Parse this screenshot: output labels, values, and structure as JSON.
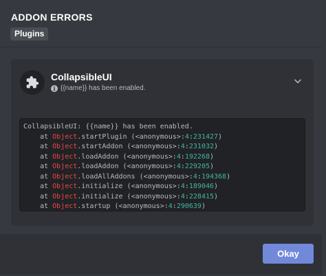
{
  "modal": {
    "title": "ADDON ERRORS",
    "tab_label": "Plugins"
  },
  "addon": {
    "name": "CollapsibleUI",
    "message": "{{name}} has been enabled.",
    "avatar_icon": "puzzle-piece-icon",
    "info_icon": "info-icon",
    "expand_icon": "chevron-down-icon"
  },
  "stack": {
    "header": "CollapsibleUI: {{name}} has been enabled.",
    "frames": [
      {
        "prefix": "at ",
        "object": "Object",
        "method": ".startPlugin",
        "location": "<anonymous>",
        "line": "4",
        "column": "231427"
      },
      {
        "prefix": "at ",
        "object": "Object",
        "method": ".startAddon",
        "location": "<anonymous>",
        "line": "4",
        "column": "231032"
      },
      {
        "prefix": "at ",
        "object": "Object",
        "method": ".loadAddon",
        "location": "<anonymous>",
        "line": "4",
        "column": "192268"
      },
      {
        "prefix": "at ",
        "object": "Object",
        "method": ".loadAddon",
        "location": "<anonymous>",
        "line": "4",
        "column": "229205"
      },
      {
        "prefix": "at ",
        "object": "Object",
        "method": ".loadAllAddons",
        "location": "<anonymous>",
        "line": "4",
        "column": "194368"
      },
      {
        "prefix": "at ",
        "object": "Object",
        "method": ".initialize",
        "location": "<anonymous>",
        "line": "4",
        "column": "189046"
      },
      {
        "prefix": "at ",
        "object": "Object",
        "method": ".initialize",
        "location": "<anonymous>",
        "line": "4",
        "column": "228415"
      },
      {
        "prefix": "at ",
        "object": "Object",
        "method": ".startup",
        "location": "<anonymous>",
        "line": "4",
        "column": "290639"
      }
    ]
  },
  "footer": {
    "okay_label": "Okay"
  },
  "colors": {
    "accent": "#7289da",
    "object_keyword": "#f04747",
    "line_numbers": "#43b5a6",
    "modal_bg": "#36393f",
    "code_bg": "#202225"
  }
}
